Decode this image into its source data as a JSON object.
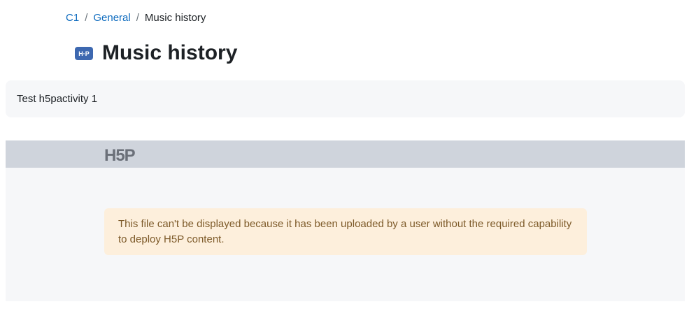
{
  "breadcrumb": {
    "items": [
      "C1",
      "General"
    ],
    "separator": "/",
    "current": "Music history"
  },
  "header": {
    "icon": "h5p-activity-icon",
    "icon_text": "H·P",
    "title": "Music history"
  },
  "intro": {
    "text": "Test h5pactivity 1"
  },
  "player": {
    "logo": "h5p-logo",
    "logo_text": "H5P",
    "alert_text": "This file can't be displayed because it has been uploaded by a user without the required capability to deploy H5P content."
  },
  "colors": {
    "link": "#0f6cbf",
    "icon_bg": "#3d68b0",
    "bar_bg": "#cfd4dc",
    "alert_bg": "#fdefdc",
    "alert_text": "#7d5a29"
  }
}
